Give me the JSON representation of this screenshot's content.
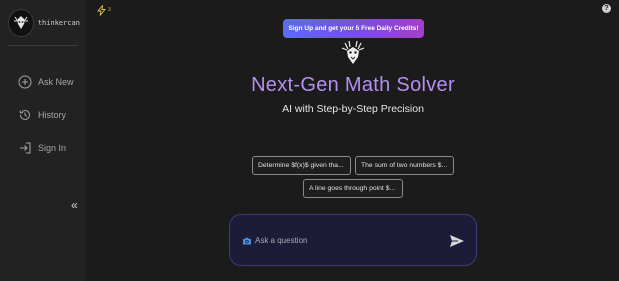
{
  "sidebar": {
    "brand_name": "thinkercan",
    "items": [
      {
        "label": "Ask New",
        "icon": "plus-circle-icon"
      },
      {
        "label": "History",
        "icon": "history-icon"
      },
      {
        "label": "Sign In",
        "icon": "sign-in-icon"
      }
    ],
    "collapse_glyph": "«"
  },
  "topbar": {
    "credits_count": "3",
    "help_glyph": "?"
  },
  "banner": {
    "signup_label": "Sign Up and get your 5 Free Daily Credits!"
  },
  "hero": {
    "title": "Next-Gen Math Solver",
    "subtitle": "AI with Step-by-Step Precision"
  },
  "suggestions": [
    "Determine $f(x)$ given tha...",
    "The sum of two numbers $...",
    "A line goes through point $..."
  ],
  "input": {
    "placeholder": "Ask a question"
  },
  "colors": {
    "accent_title": "#b48ff0",
    "banner_gradient_start": "#5a6cf0",
    "banner_gradient_end": "#a53ec8",
    "input_bg": "#1c1b38"
  }
}
